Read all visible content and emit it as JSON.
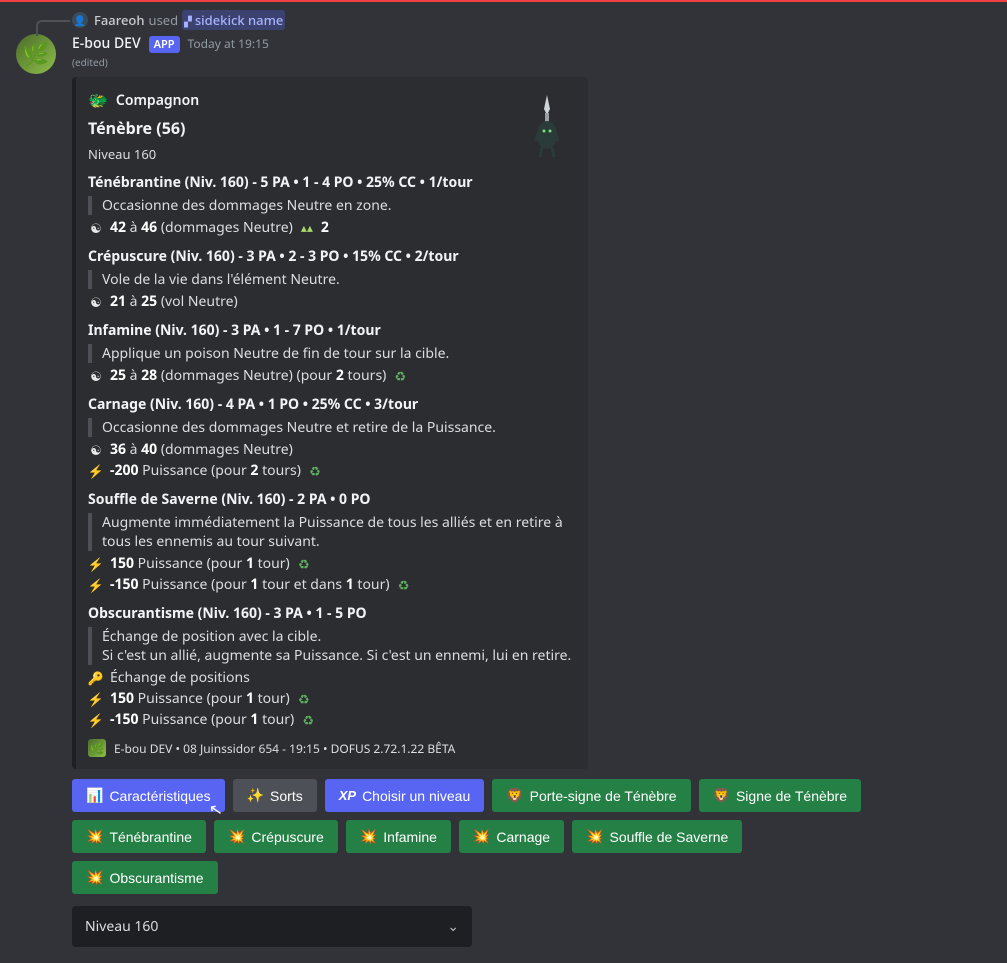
{
  "reply": {
    "user": "Faareoh",
    "used": "used",
    "command": "sidekick name"
  },
  "bot": {
    "name": "E-bou DEV",
    "badge": "APP",
    "timestamp": "Today at 19:15",
    "edited": "(edited)"
  },
  "embed": {
    "section_icon": "🐲",
    "section": "Compagnon",
    "name": "Ténèbre (56)",
    "level": "Niveau 160",
    "spells": [
      {
        "head": "Ténébrantine (Niv. 160) - 5 PA • 1 - 4 PO • 25% CC • 1/tour",
        "quote": "Occasionne des dommages Neutre en zone.",
        "effects": [
          {
            "icon": "neutral",
            "pre": "",
            "b1": "42",
            "mid": " à ",
            "b2": "46",
            "post": " (dommages Neutre) ",
            "tail_icon": "area",
            "tail_b": "2"
          }
        ]
      },
      {
        "head": "Crépuscure (Niv. 160) - 3 PA • 2 - 3 PO • 15% CC • 2/tour",
        "quote": "Vole de la vie dans l'élément Neutre.",
        "effects": [
          {
            "icon": "neutral",
            "pre": "",
            "b1": "21",
            "mid": " à ",
            "b2": "25",
            "post": " (vol Neutre)"
          }
        ]
      },
      {
        "head": "Infamine (Niv. 160) - 3 PA • 1 - 7 PO • 1/tour",
        "quote": "Applique un poison Neutre de fin de tour sur la cible.",
        "effects": [
          {
            "icon": "neutral",
            "pre": "",
            "b1": "25",
            "mid": " à ",
            "b2": "28",
            "post": " (dommages Neutre) (pour ",
            "b3": "2",
            "post2": " tours) ",
            "tail_icon": "poison"
          }
        ]
      },
      {
        "head": "Carnage (Niv. 160) - 4 PA • 1 PO • 25% CC • 3/tour",
        "quote": "Occasionne des dommages Neutre et retire de la Puissance.",
        "effects": [
          {
            "icon": "neutral",
            "pre": "",
            "b1": "36",
            "mid": " à ",
            "b2": "40",
            "post": " (dommages Neutre)"
          },
          {
            "icon": "bolt",
            "pre": "",
            "b1": "-200",
            "post": " Puissance (pour ",
            "b3": "2",
            "post2": " tours) ",
            "tail_icon": "poison"
          }
        ]
      },
      {
        "head": "Souffle de Saverne (Niv. 160) - 2 PA • 0 PO",
        "quote": "Augmente immédiatement la Puissance de tous les alliés et en retire à tous les ennemis au tour suivant.",
        "effects": [
          {
            "icon": "bolt",
            "b1": "150",
            "post": " Puissance (pour ",
            "b3": "1",
            "post2": " tour) ",
            "tail_icon": "poison"
          },
          {
            "icon": "bolt",
            "b1": "-150",
            "post": " Puissance (pour ",
            "b3": "1",
            "post2": " tour et dans ",
            "b4": "1",
            "post3": " tour) ",
            "tail_icon": "poison"
          }
        ]
      },
      {
        "head": "Obscurantisme (Niv. 160) - 3 PA • 1 - 5 PO",
        "quote": "Échange de position avec la cible.\nSi c'est un allié, augmente sa Puissance. Si c'est un ennemi, lui en retire.",
        "effects": [
          {
            "icon": "swap",
            "plain": "Échange de positions"
          },
          {
            "icon": "bolt",
            "b1": "150",
            "post": " Puissance (pour ",
            "b3": "1",
            "post2": " tour) ",
            "tail_icon": "poison"
          },
          {
            "icon": "bolt",
            "b1": "-150",
            "post": " Puissance (pour ",
            "b3": "1",
            "post2": " tour) ",
            "tail_icon": "poison"
          }
        ]
      }
    ],
    "footer": "E-bou DEV • 08 Juinssidor 654 - 19:15 • DOFUS 2.72.1.22 BÊTA"
  },
  "buttons": {
    "row1": [
      {
        "style": "primary",
        "emoji": "📊",
        "label": "Caractéristiques"
      },
      {
        "style": "secondary",
        "emoji": "✨",
        "label": "Sorts"
      },
      {
        "style": "primary",
        "xp": "XP",
        "label": "Choisir un niveau"
      },
      {
        "style": "success",
        "emoji": "🦁",
        "label": "Porte-signe de Ténèbre"
      },
      {
        "style": "success",
        "emoji": "🦁",
        "label": "Signe de Ténèbre"
      }
    ],
    "row2": [
      {
        "style": "success",
        "emoji": "💥",
        "label": "Ténébrantine"
      },
      {
        "style": "success",
        "emoji": "💥",
        "label": "Crépuscure"
      },
      {
        "style": "success",
        "emoji": "💥",
        "label": "Infamine"
      },
      {
        "style": "success",
        "emoji": "💥",
        "label": "Carnage"
      },
      {
        "style": "success",
        "emoji": "💥",
        "label": "Souffle de Saverne"
      }
    ],
    "row3": [
      {
        "style": "success",
        "emoji": "💥",
        "label": "Obscurantisme"
      }
    ]
  },
  "select": {
    "label": "Niveau 160"
  }
}
